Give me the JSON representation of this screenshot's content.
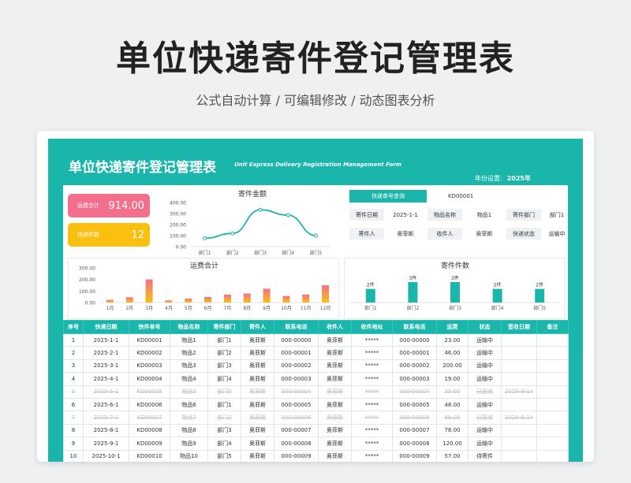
{
  "hero": {
    "title": "单位快递寄件登记管理表",
    "subtitle": "公式自动计算 /  可编辑修改  / 动态图表分析"
  },
  "sheet": {
    "title": "单位快递寄件登记管理表",
    "title_en": "Unit Express Delivery Registration Management Form",
    "year_label": "年份设置:",
    "year_value": "2025年"
  },
  "kpis": [
    {
      "label": "运费合计",
      "value": "914.00",
      "color": "#f46f8b"
    },
    {
      "label": "快递件数",
      "value": "12",
      "color": "#fbbf10"
    }
  ],
  "query": {
    "title": "快递单号查询",
    "value": "KD00001",
    "cells": [
      {
        "label": "寄件日期",
        "value": "2025-1-1"
      },
      {
        "label": "物品名称",
        "value": "物品1"
      },
      {
        "label": "寄件部门",
        "value": "部门1"
      },
      {
        "label": "寄件人",
        "value": "奥菲斯"
      },
      {
        "label": "收件人",
        "value": "奥菲斯"
      },
      {
        "label": "快递状态",
        "value": "运输中"
      }
    ]
  },
  "chart_data": [
    {
      "type": "line",
      "title": "寄件金额",
      "categories": [
        "部门1",
        "部门2",
        "部门3",
        "部门4",
        "部门5"
      ],
      "values": [
        76,
        120,
        334,
        285,
        100
      ],
      "yticks": [
        "400.00",
        "300.00",
        "200.00",
        "100.00",
        "0.00"
      ],
      "ylim": [
        0,
        400
      ],
      "color": "#1ab5ab"
    },
    {
      "type": "bar",
      "title": "运费合计",
      "categories": [
        "1月",
        "2月",
        "3月",
        "4月",
        "5月",
        "6月",
        "7月",
        "8月",
        "9月",
        "10月",
        "11月",
        "12月"
      ],
      "values": [
        23,
        46,
        200,
        19,
        35,
        48,
        69,
        78,
        120,
        57,
        70,
        150
      ],
      "yticks": [
        "300.00",
        "200.00",
        "100.00",
        "0.00"
      ],
      "ylim": [
        0,
        300
      ],
      "colors": [
        "#f46f8b",
        "#fbbf10"
      ]
    },
    {
      "type": "bar",
      "title": "寄件件数",
      "categories": [
        "部门1",
        "部门2",
        "部门3",
        "部门4",
        "部门5"
      ],
      "values": [
        2,
        3,
        3,
        2,
        2
      ],
      "labels": [
        "2件",
        "3件",
        "3件",
        "2件",
        "2件"
      ],
      "ylim": [
        0,
        3
      ],
      "color": "#1ab5ab"
    }
  ],
  "table": {
    "headers": [
      "序号",
      "快递日期",
      "快件单号",
      "物品名称",
      "寄件部门",
      "寄件人",
      "联系电话",
      "收件人",
      "收件地址",
      "联系电话",
      "运费",
      "状态",
      "签收日期",
      "备注"
    ],
    "rows": [
      {
        "cancel": false,
        "cells": [
          "1",
          "2025-1-1",
          "KD00001",
          "物品1",
          "部门1",
          "奥菲斯",
          "000-00000",
          "奥菲斯",
          "*****",
          "000-00000",
          "23.00",
          "运输中",
          "",
          ""
        ]
      },
      {
        "cancel": false,
        "cells": [
          "2",
          "2025-2-1",
          "KD00002",
          "物品2",
          "部门2",
          "奥菲斯",
          "000-00001",
          "奥菲斯",
          "*****",
          "000-00001",
          "46.00",
          "运输中",
          "",
          ""
        ]
      },
      {
        "cancel": false,
        "cells": [
          "3",
          "2025-3-1",
          "KD00003",
          "物品3",
          "部门3",
          "奥菲斯",
          "000-00002",
          "奥菲斯",
          "*****",
          "000-00002",
          "200.00",
          "运输中",
          "",
          ""
        ]
      },
      {
        "cancel": false,
        "cells": [
          "4",
          "2025-4-1",
          "KD00004",
          "物品4",
          "部门4",
          "奥菲斯",
          "000-00003",
          "奥菲斯",
          "*****",
          "000-00003",
          "19.00",
          "运输中",
          "",
          ""
        ]
      },
      {
        "cancel": true,
        "cells": [
          "5",
          "2025-5-1",
          "KD00005",
          "物品5",
          "部门5",
          "奥菲斯",
          "000-00004",
          "奥菲斯",
          "*****",
          "000-00004",
          "35.00",
          "已签收",
          "2025-9-14",
          ""
        ]
      },
      {
        "cancel": false,
        "cells": [
          "6",
          "2025-6-1",
          "KD00006",
          "物品6",
          "部门1",
          "奥菲斯",
          "000-00005",
          "奥菲斯",
          "*****",
          "000-00005",
          "48.00",
          "运输中",
          "",
          ""
        ]
      },
      {
        "cancel": true,
        "cells": [
          "7",
          "2025-7-1",
          "KD00007",
          "物品7",
          "部门2",
          "奥菲斯",
          "000-00006",
          "奥菲斯",
          "*****",
          "000-00006",
          "69.00",
          "已签收",
          "2025-9-14",
          ""
        ]
      },
      {
        "cancel": false,
        "cells": [
          "8",
          "2025-8-1",
          "KD00008",
          "物品8",
          "部门3",
          "奥菲斯",
          "000-00007",
          "奥菲斯",
          "*****",
          "000-00007",
          "78.00",
          "运输中",
          "",
          ""
        ]
      },
      {
        "cancel": false,
        "cells": [
          "9",
          "2025-9-1",
          "KD00009",
          "物品9",
          "部门4",
          "奥菲斯",
          "000-00008",
          "奥菲斯",
          "*****",
          "000-00008",
          "120.00",
          "运输中",
          "",
          ""
        ]
      },
      {
        "cancel": false,
        "cells": [
          "10",
          "2025-10-1",
          "KD00010",
          "物品10",
          "部门5",
          "奥菲斯",
          "000-00009",
          "奥菲斯",
          "*****",
          "000-00009",
          "57.00",
          "待寄件",
          "",
          ""
        ]
      }
    ]
  }
}
